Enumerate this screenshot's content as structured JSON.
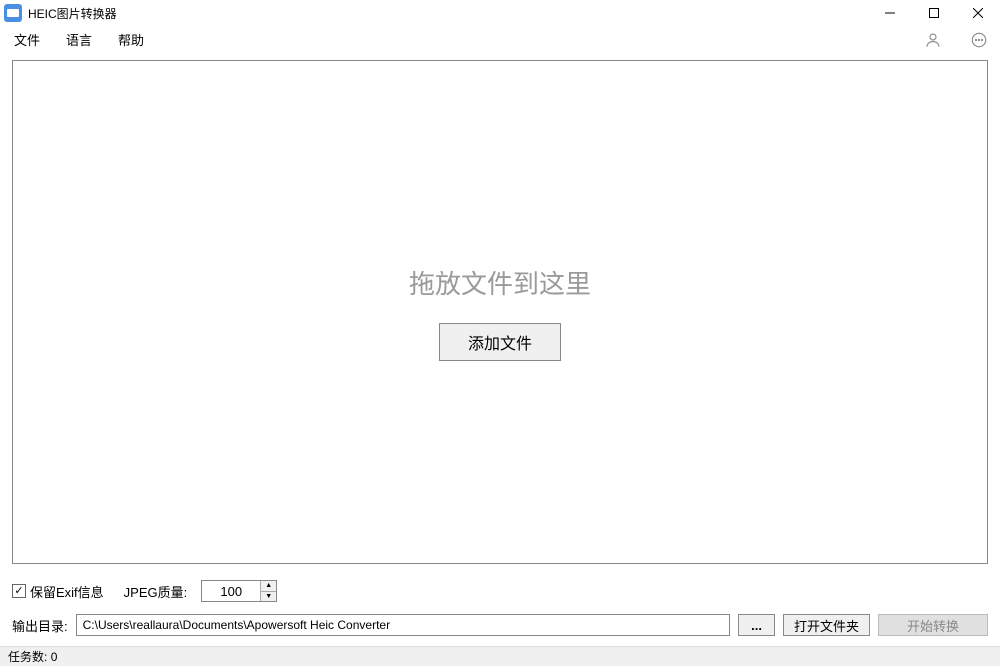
{
  "titlebar": {
    "title": "HEIC图片转换器"
  },
  "menubar": {
    "file": "文件",
    "language": "语言",
    "help": "帮助"
  },
  "dropzone": {
    "text": "拖放文件到这里",
    "add_button": "添加文件"
  },
  "options": {
    "keep_exif_label": "保留Exif信息",
    "keep_exif_checked": true,
    "jpeg_quality_label": "JPEG质量:",
    "jpeg_quality_value": "100"
  },
  "output": {
    "label": "输出目录:",
    "path": "C:\\Users\\reallaura\\Documents\\Apowersoft Heic Converter",
    "browse_button": "...",
    "open_folder_button": "打开文件夹",
    "start_button": "开始转换"
  },
  "statusbar": {
    "task_count_label": "任务数:",
    "task_count": "0"
  }
}
